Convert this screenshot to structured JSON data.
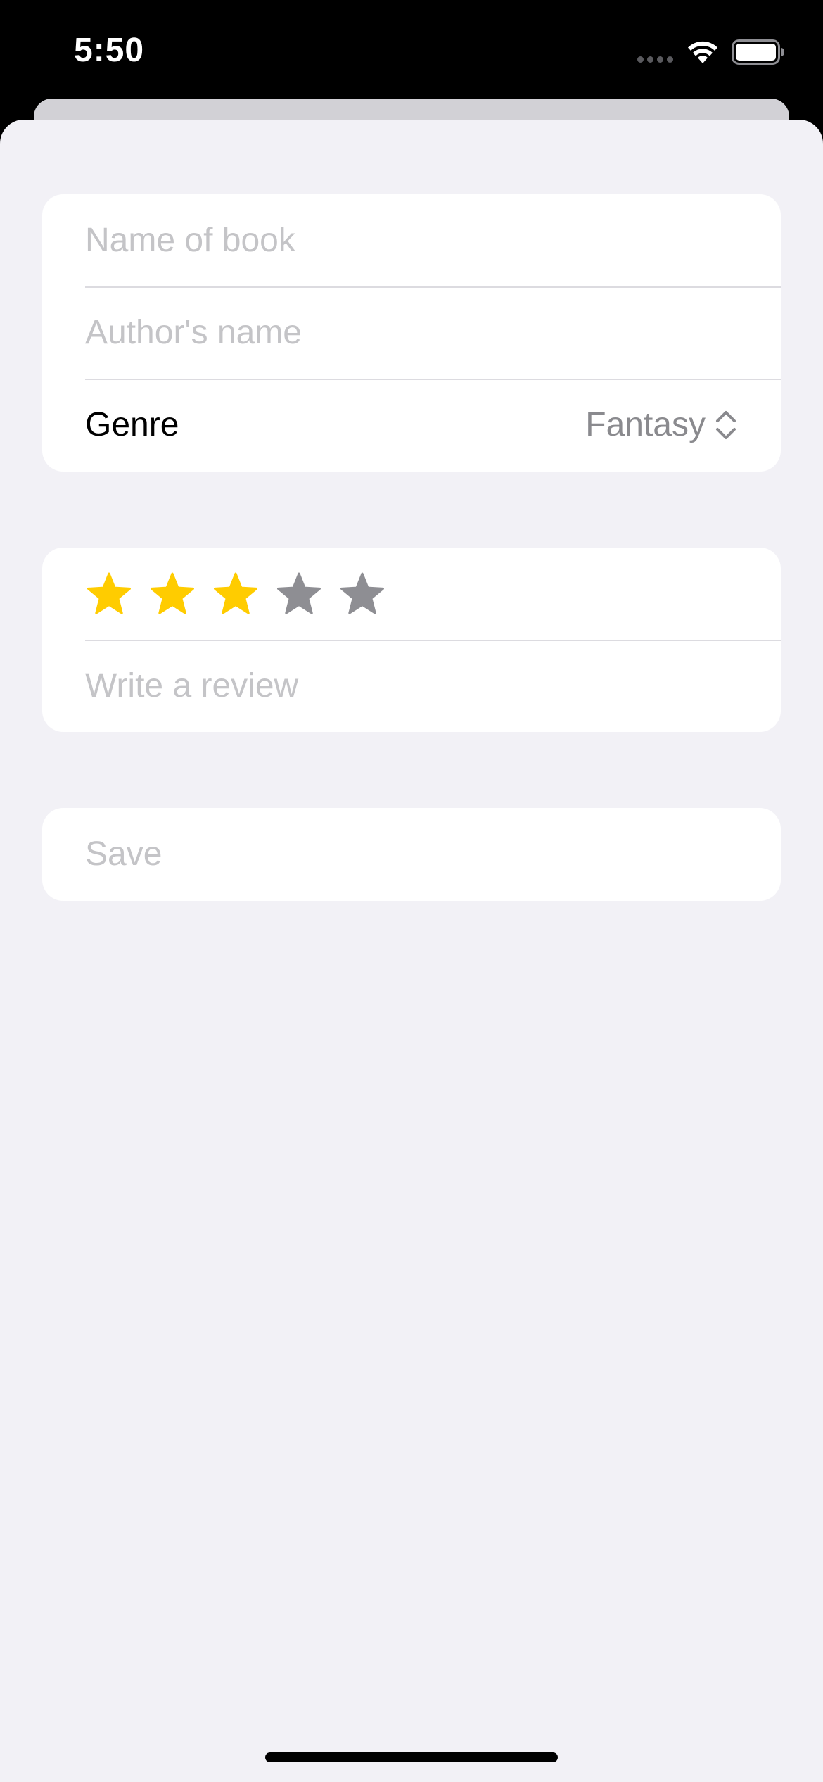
{
  "status_bar": {
    "time": "5:50",
    "wifi_icon": "wifi-icon",
    "battery_icon": "battery-icon"
  },
  "form": {
    "book_section": {
      "title_placeholder": "Name of book",
      "title_value": "",
      "author_placeholder": "Author's name",
      "author_value": "",
      "genre_label": "Genre",
      "genre_value": "Fantasy",
      "genre_picker_icon": "chevron-up-down-icon"
    },
    "review_section": {
      "rating": 3,
      "max_rating": 5,
      "star_icon": "star-icon",
      "review_placeholder": "Write a review",
      "review_value": ""
    },
    "save_label": "Save"
  },
  "colors": {
    "star_filled": "#FFCC00",
    "star_empty": "#8E8E93",
    "placeholder": "#C4C4C7",
    "background": "#F2F1F6"
  }
}
